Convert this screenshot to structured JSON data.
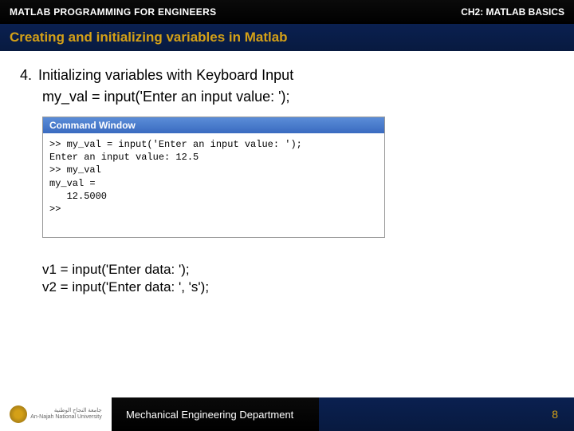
{
  "header": {
    "left": "MATLAB PROGRAMMING FOR ENGINEERS",
    "right_prefix": "CH2:",
    "right_text": " MATLAB BASICS"
  },
  "subheader": {
    "title": "Creating and initializing variables in Matlab"
  },
  "content": {
    "item_number": "4.",
    "item_title": "Initializing variables with Keyboard Input",
    "code_example": "my_val = input('Enter an input value: ');"
  },
  "command_window": {
    "title": "Command Window",
    "lines": [
      ">> my_val = input('Enter an input value: ');",
      "Enter an input value: 12.5",
      ">> my_val",
      "",
      "my_val =",
      "",
      "   12.5000",
      "",
      ">> "
    ]
  },
  "examples": {
    "line1": "v1 = input('Enter data: ');",
    "line2": "v2 = input('Enter data: ', 's');"
  },
  "footer": {
    "logo_ar": "جامعة النجاح الوطنية",
    "logo_en": "An-Najah National University",
    "department": "Mechanical Engineering Department",
    "page_number": "8"
  }
}
